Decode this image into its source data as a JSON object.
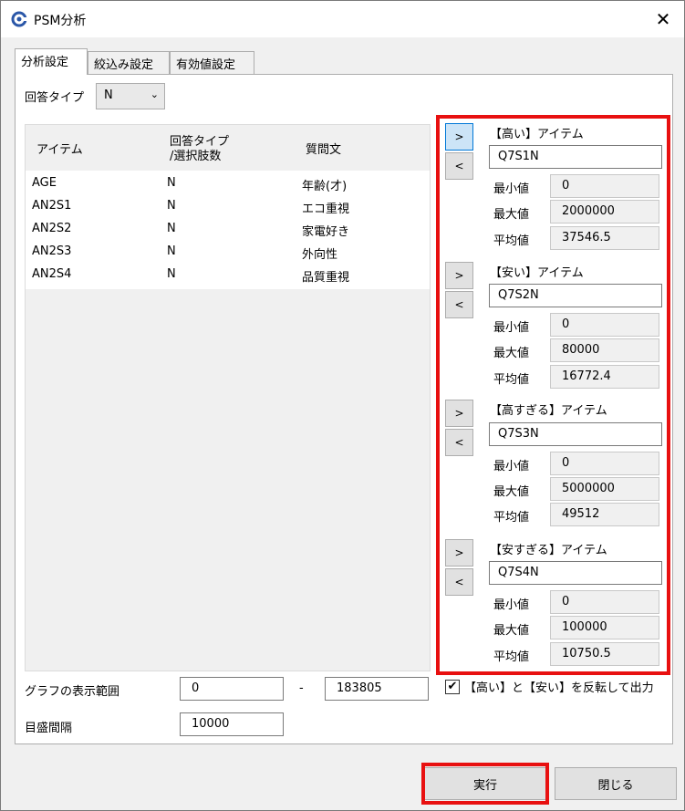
{
  "window": {
    "title": "PSM分析",
    "close_glyph": "✕"
  },
  "tabs": [
    {
      "label": "分析設定",
      "active": true
    },
    {
      "label": "絞込み設定",
      "active": false
    },
    {
      "label": "有効値設定",
      "active": false
    }
  ],
  "answer_type": {
    "label": "回答タイプ",
    "value": "N",
    "chevron": "⌄"
  },
  "item_list": {
    "columns": [
      "アイテム",
      "回答タイプ",
      "/選択肢数",
      "質問文"
    ],
    "rows": [
      {
        "item": "AGE",
        "type": "N",
        "question": "年齢(才)"
      },
      {
        "item": "AN2S1",
        "type": "N",
        "question": "エコ重視"
      },
      {
        "item": "AN2S2",
        "type": "N",
        "question": "家電好き"
      },
      {
        "item": "AN2S3",
        "type": "N",
        "question": "外向性"
      },
      {
        "item": "AN2S4",
        "type": "N",
        "question": "品質重視"
      }
    ]
  },
  "arrows": {
    "add": ">",
    "remove": "<"
  },
  "stat_labels": {
    "min": "最小値",
    "max": "最大値",
    "avg": "平均値"
  },
  "groups": [
    {
      "title": "【高い】アイテム",
      "item": "Q7S1N",
      "min": "0",
      "max": "2000000",
      "avg": "37546.5"
    },
    {
      "title": "【安い】アイテム",
      "item": "Q7S2N",
      "min": "0",
      "max": "80000",
      "avg": "16772.4"
    },
    {
      "title": "【高すぎる】アイテム",
      "item": "Q7S3N",
      "min": "0",
      "max": "5000000",
      "avg": "49512"
    },
    {
      "title": "【安すぎる】アイテム",
      "item": "Q7S4N",
      "min": "0",
      "max": "100000",
      "avg": "10750.5"
    }
  ],
  "graph_range": {
    "label": "グラフの表示範囲",
    "min": "0",
    "separator": "-",
    "max": "183805"
  },
  "scale_interval": {
    "label": "目盛間隔",
    "value": "10000"
  },
  "invert_option": {
    "checked": true,
    "check_glyph": "✔",
    "label": "【高い】と【安い】を反転して出力"
  },
  "buttons": {
    "run": "実行",
    "close": "閉じる"
  },
  "colors": {
    "highlight": "#e81010",
    "selected_button": "#cce4f7"
  }
}
